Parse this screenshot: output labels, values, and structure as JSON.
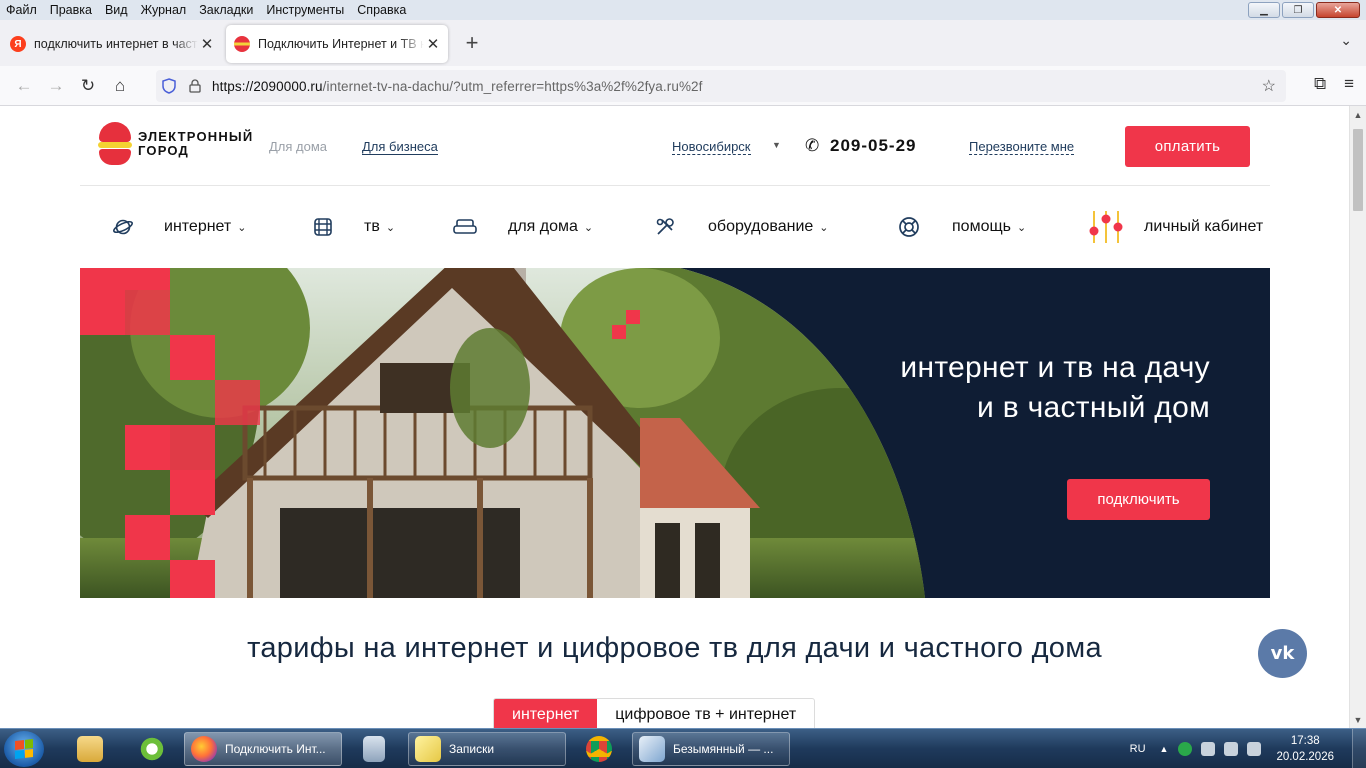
{
  "browser": {
    "menu": [
      "Файл",
      "Правка",
      "Вид",
      "Журнал",
      "Закладки",
      "Инструменты",
      "Справка"
    ],
    "tabs": [
      {
        "title": "подключить интернет в частн",
        "favicon": "yandex-icon"
      },
      {
        "title": "Подключить Интернет и ТВ на",
        "favicon": "elektronny-gorod-icon"
      }
    ],
    "url_host": "https://2090000.ru",
    "url_path": "/internet-tv-na-dachu/?utm_referrer=https%3a%2f%2fya.ru%2f"
  },
  "site": {
    "logo_text": "ЭЛЕКТРОННЫЙ ГОРОД",
    "link_home": "Для дома",
    "link_business": "Для бизнеса",
    "city": "Новосибирск",
    "phone": "209-05-29",
    "callback": "Перезвоните мне",
    "pay_button": "оплатить",
    "nav": [
      {
        "label": "интернет",
        "icon": "planet-icon"
      },
      {
        "label": "тв",
        "icon": "film-icon"
      },
      {
        "label": "для дома",
        "icon": "sofa-icon"
      },
      {
        "label": "оборудование",
        "icon": "tools-icon"
      },
      {
        "label": "помощь",
        "icon": "lifebuoy-icon"
      }
    ],
    "cabinet": "личный кабинет",
    "hero_line1": "интернет и тв на дачу",
    "hero_line2": "и в частный дом",
    "hero_button": "подключить",
    "section_title": "тарифы на интернет и цифровое тв для дачи и частного дома",
    "tabs": [
      "интернет",
      "цифровое тв + интернет"
    ],
    "social": "vk-icon"
  },
  "colors": {
    "accent": "#f0364a",
    "navy": "#0f1d34",
    "link": "#213d5e"
  },
  "taskbar": {
    "items": [
      {
        "label": "",
        "icon": "explorer-icon"
      },
      {
        "label": "",
        "icon": "app-icon"
      },
      {
        "label": "Подключить Инт...",
        "icon": "firefox-icon"
      },
      {
        "label": "",
        "icon": "calculator-icon"
      },
      {
        "label": "Записки",
        "icon": "notes-icon"
      },
      {
        "label": "",
        "icon": "chrome-icon"
      },
      {
        "label": "Безымянный — ...",
        "icon": "paint-icon"
      }
    ],
    "lang": "RU",
    "time": "17:38",
    "date": "20.02.2026"
  }
}
